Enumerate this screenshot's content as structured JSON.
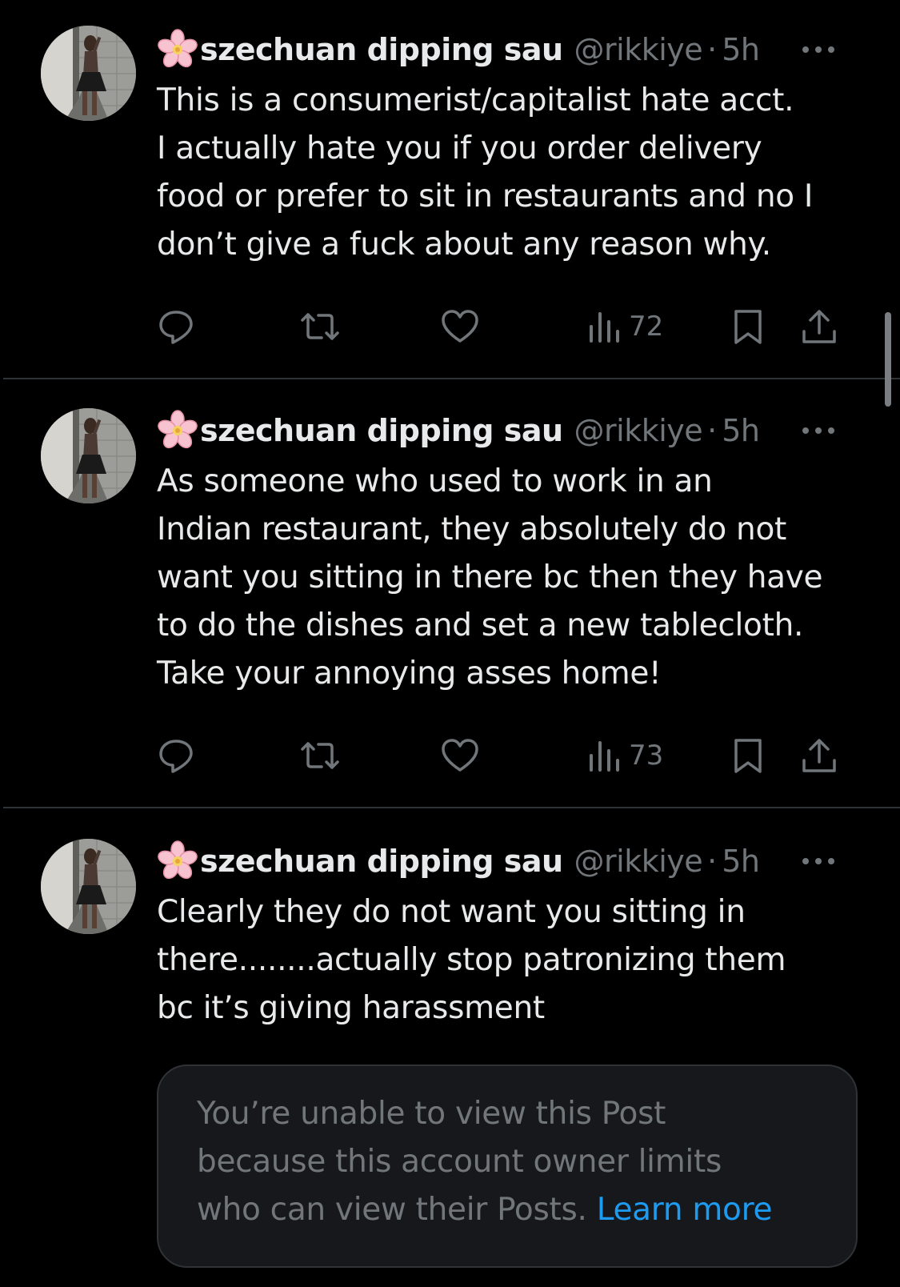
{
  "colors": {
    "background": "#000000",
    "text_primary": "#e7e9ea",
    "text_secondary": "#71767b",
    "divider": "#2f3336",
    "link": "#1d9bf0",
    "notice_bg": "#16181c"
  },
  "icons": {
    "name_emoji": "cherry-blossom-icon",
    "reply": "reply-icon",
    "repost": "repost-icon",
    "like": "heart-icon",
    "views": "views-icon",
    "bookmark": "bookmark-icon",
    "share": "share-icon",
    "more": "more-icon"
  },
  "tweets": [
    {
      "display_name": "szechuan dipping sau",
      "handle": "@rikkiye",
      "separator": "·",
      "time": "5h",
      "lines": [
        "This is a consumerist/capitalist hate acct.",
        "I actually hate you if you order delivery",
        "food or prefer to sit in restaurants and no I",
        "don’t give a fuck about any reason why."
      ],
      "views": "72"
    },
    {
      "display_name": "szechuan dipping sau",
      "handle": "@rikkiye",
      "separator": "·",
      "time": "5h",
      "lines": [
        "As someone who used to work in an",
        "Indian restaurant, they absolutely do not",
        "want you sitting in there bc then they have",
        "to do the dishes and set a new tablecloth.",
        "Take your annoying asses home!"
      ],
      "views": "73"
    },
    {
      "display_name": "szechuan dipping sau",
      "handle": "@rikkiye",
      "separator": "·",
      "time": "5h",
      "lines": [
        "Clearly they do not want you sitting in",
        "there........actually stop patronizing them",
        "bc it’s giving harassment"
      ]
    }
  ],
  "notice": {
    "line1": "You’re unable to view this Post",
    "line2": "because this account owner limits",
    "line3": "who can view their Posts.",
    "link": "Learn more"
  }
}
